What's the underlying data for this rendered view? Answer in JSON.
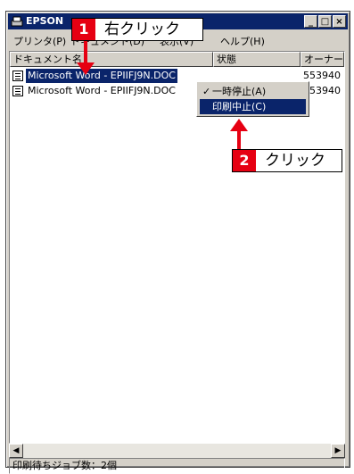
{
  "window": {
    "title": "EPSON"
  },
  "menu": [
    "プリンタ(P)",
    "ドキュメント(D)",
    "表示(V)",
    "ヘルプ(H)"
  ],
  "columns": [
    "ドキュメント名",
    "状態",
    "オーナー"
  ],
  "rows": [
    {
      "name": "Microsoft Word - EPIIFJ9N.DOC",
      "owner": "553940",
      "selected": true
    },
    {
      "name": "Microsoft Word - EPIIFJ9N.DOC",
      "owner": "553940",
      "selected": false
    }
  ],
  "context_menu": [
    "一時停止(A)",
    "印刷中止(C)"
  ],
  "status_text": "印刷待ちジョブ数：2個",
  "callouts": [
    {
      "num": "1",
      "text": "右クリック"
    },
    {
      "num": "2",
      "text": "クリック"
    }
  ],
  "colors": {
    "accent": "#e60012",
    "title_bar": "#0a246a",
    "chrome": "#d4d0c8"
  }
}
